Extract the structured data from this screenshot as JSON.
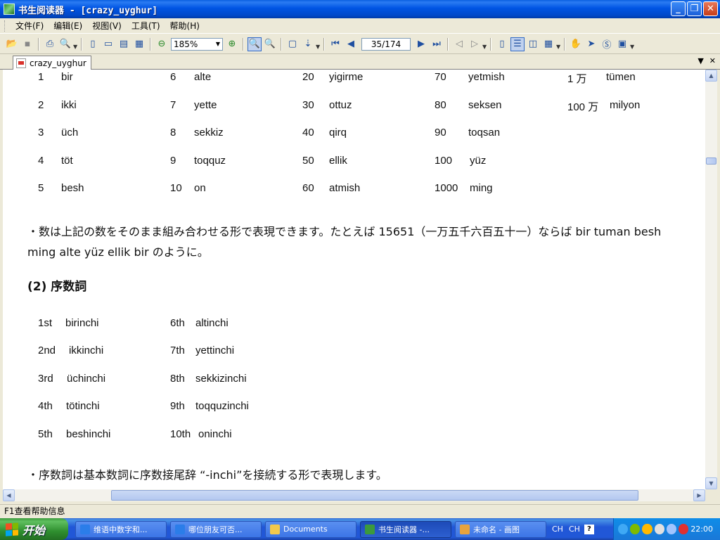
{
  "window": {
    "title": "书生阅读器 - [crazy_uyghur]",
    "min_label": "_",
    "max_label": "❐",
    "close_label": "✕"
  },
  "menu": {
    "items": [
      {
        "label": "文件(F)"
      },
      {
        "label": "编辑(E)"
      },
      {
        "label": "视图(V)"
      },
      {
        "label": "工具(T)"
      },
      {
        "label": "帮助(H)"
      }
    ]
  },
  "toolbar": {
    "zoom_value": "185%",
    "page_indicator": "35/174",
    "icons": [
      "open-folder-icon",
      "save-icon",
      "print-icon",
      "search-icon",
      "single-page-icon",
      "zoom-out-icon",
      "zoom-in-icon",
      "first-page-icon",
      "last-page-icon",
      "hand-tool-icon",
      "select-arrow-icon"
    ]
  },
  "tab": {
    "label": "crazy_uyghur"
  },
  "cardinals": [
    {
      "num": "1",
      "word": "bir"
    },
    {
      "num": "2",
      "word": "ikki"
    },
    {
      "num": "3",
      "word": "üch"
    },
    {
      "num": "4",
      "word": "töt"
    },
    {
      "num": "5",
      "word": "besh"
    },
    {
      "num": "6",
      "word": "alte"
    },
    {
      "num": "7",
      "word": "yette"
    },
    {
      "num": "8",
      "word": "sekkiz"
    },
    {
      "num": "9",
      "word": "toqquz"
    },
    {
      "num": "10",
      "word": "on"
    },
    {
      "num": "20",
      "word": "yigirme"
    },
    {
      "num": "30",
      "word": "ottuz"
    },
    {
      "num": "40",
      "word": "qirq"
    },
    {
      "num": "50",
      "word": "ellik"
    },
    {
      "num": "60",
      "word": "atmish"
    },
    {
      "num": "70",
      "word": "yetmish"
    },
    {
      "num": "80",
      "word": "seksen"
    },
    {
      "num": "90",
      "word": "toqsan"
    },
    {
      "num": "100",
      "word": "yüz"
    },
    {
      "num": "1000",
      "word": "ming"
    },
    {
      "num": "1 万",
      "word": "tümen"
    },
    {
      "num": "100 万",
      "word": "milyon"
    }
  ],
  "paragraph1": "・数は上記の数をそのまま組み合わせる形で表現できます。たとえば 15651（一万五千六百五十一）ならば bir tuman besh ming alte yüz ellik bir のように。",
  "section_title": "(2) 序数詞",
  "ordinals": [
    {
      "num": "1st",
      "word": "birinchi"
    },
    {
      "num": "2nd",
      "word": "ikkinchi"
    },
    {
      "num": "3rd",
      "word": "üchinchi"
    },
    {
      "num": "4th",
      "word": "tötinchi"
    },
    {
      "num": "5th",
      "word": "beshinchi"
    },
    {
      "num": "6th",
      "word": "altinchi"
    },
    {
      "num": "7th",
      "word": "yettinchi"
    },
    {
      "num": "8th",
      "word": "sekkizinchi"
    },
    {
      "num": "9th",
      "word": "toqquzinchi"
    },
    {
      "num": "10th",
      "word": "oninchi"
    }
  ],
  "paragraph2": "・序数詞は基本数詞に序数接尾辞 “-inchi”を接続する形で表現します。",
  "status": {
    "text": "F1查看帮助信息"
  },
  "taskbar": {
    "start_label": "开始",
    "tasks": [
      {
        "label": "维语中数字和...",
        "icon": "ie-icon",
        "color": "#2b7de9"
      },
      {
        "label": "哪位朋友可否...",
        "icon": "ie-icon",
        "color": "#2b7de9"
      },
      {
        "label": "Documents",
        "icon": "folder-icon",
        "color": "#f2c94c"
      },
      {
        "label": "书生阅读器 -...",
        "icon": "reader-icon",
        "color": "#3c9a3c"
      },
      {
        "label": "未命名 - 画图",
        "icon": "paint-icon",
        "color": "#e8a33c"
      }
    ],
    "lang1": "CH",
    "lang2": "CH",
    "help_label": "?",
    "clock": "22:00"
  }
}
